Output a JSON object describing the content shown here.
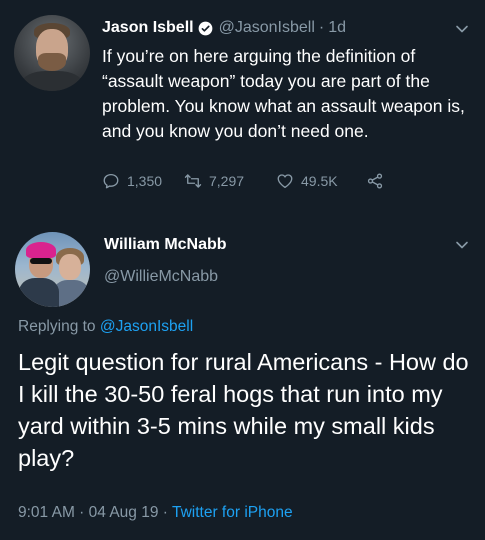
{
  "tweet1": {
    "author_name": "Jason Isbell",
    "handle": "@JasonIsbell",
    "separator": "·",
    "time": "1d",
    "text": "If you’re on here arguing the definition of “assault weapon” today you are part of the problem. You know what an assault weapon is, and you know you don’t need one.",
    "replies": "1,350",
    "retweets": "7,297",
    "likes": "49.5K",
    "verified": true
  },
  "tweet2": {
    "author_name": "William McNabb",
    "handle": "@WillieMcNabb",
    "replying_prefix": "Replying to ",
    "replying_to": "@JasonIsbell",
    "text": "Legit question for rural Americans - How do I kill the 30-50 feral hogs that run into my yard within 3-5 mins while my small kids play?",
    "time_date": "9:01 AM · 04 Aug 19 · ",
    "source": "Twitter for iPhone"
  },
  "icons": {
    "verified": "verified-badge-icon",
    "chevron": "chevron-down-icon",
    "reply": "reply-icon",
    "retweet": "retweet-icon",
    "like": "heart-icon",
    "share": "share-icon"
  },
  "colors": {
    "background": "#141d26",
    "muted": "#8899a6",
    "accent": "#1da1f2",
    "text": "#ffffff"
  }
}
